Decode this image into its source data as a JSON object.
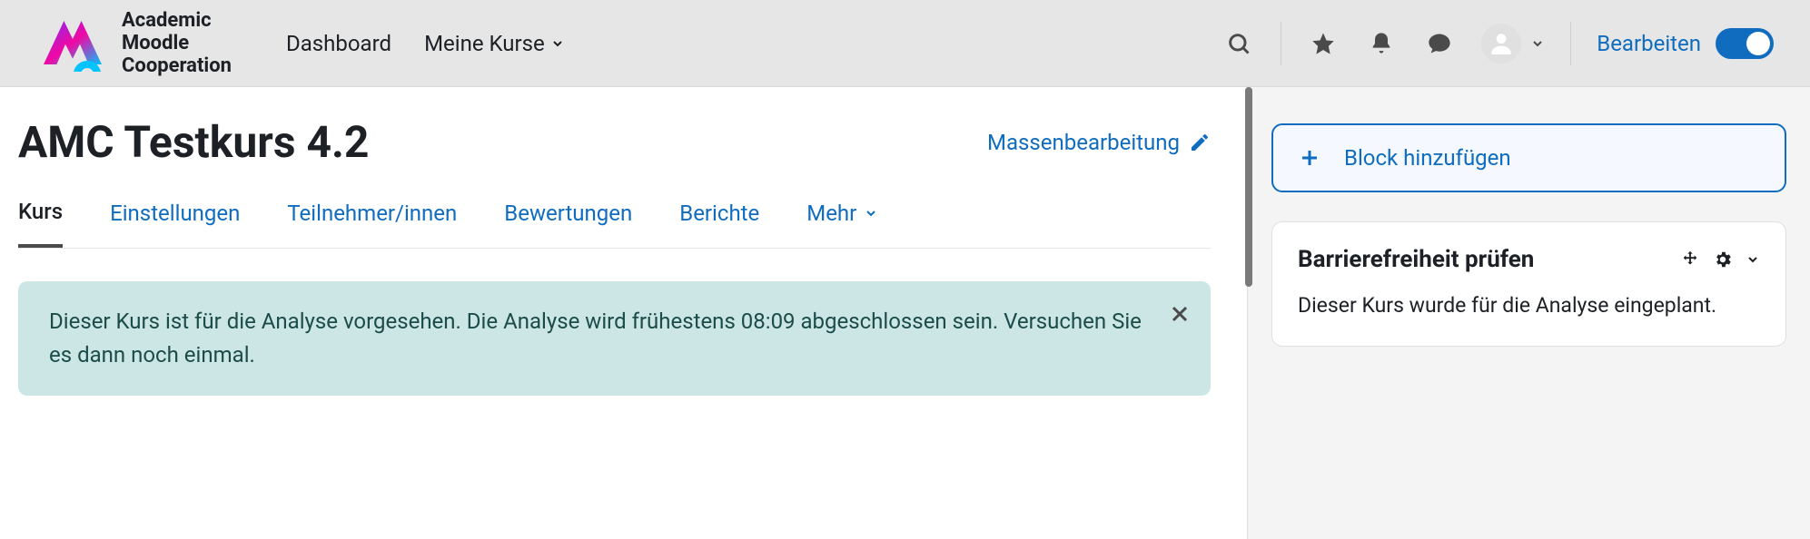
{
  "brand": {
    "line1": "Academic",
    "line2": "Moodle",
    "line3": "Cooperation"
  },
  "nav": {
    "dashboard": "Dashboard",
    "my_courses": "Meine Kurse"
  },
  "edit_mode": {
    "label": "Bearbeiten"
  },
  "page": {
    "title": "AMC Testkurs 4.2",
    "mass_edit": "Massenbearbeitung"
  },
  "tabs": {
    "course": "Kurs",
    "settings": "Einstellungen",
    "participants": "Teilnehmer/innen",
    "grades": "Bewertungen",
    "reports": "Berichte",
    "more": "Mehr"
  },
  "alert": {
    "text": "Dieser Kurs ist für die Analyse vorgesehen. Die Analyse wird frühestens 08:09 abgeschlossen sein. Versuchen Sie es dann noch einmal."
  },
  "sidebar": {
    "add_block": "Block hinzufügen",
    "block_title": "Barrierefreiheit prüfen",
    "block_body": "Dieser Kurs wurde für die Analyse eingeplant."
  }
}
